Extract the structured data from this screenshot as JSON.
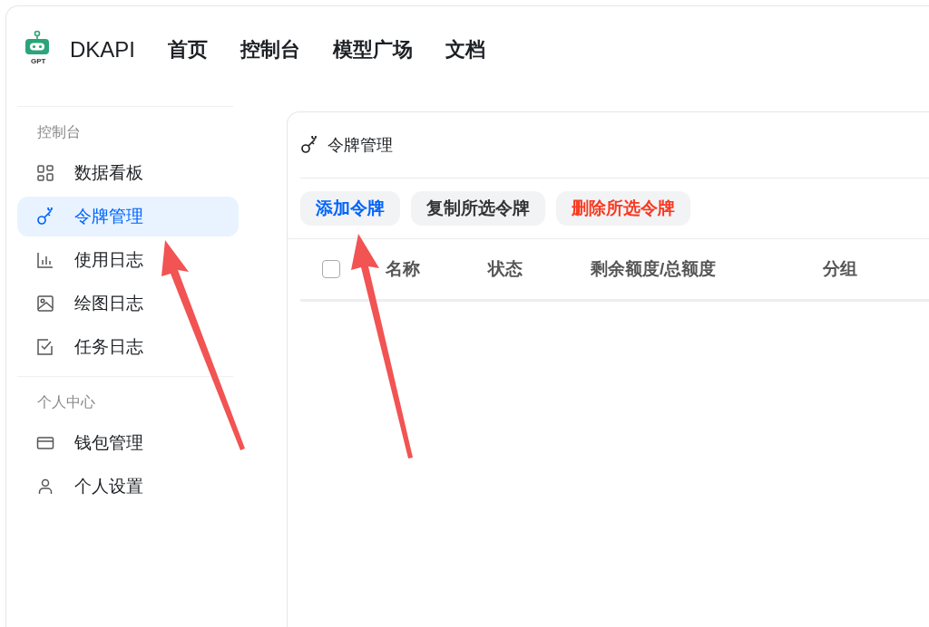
{
  "header": {
    "logo_caption": "GPT",
    "brand": "DKAPI",
    "nav": [
      {
        "label": "首页"
      },
      {
        "label": "控制台"
      },
      {
        "label": "模型广场"
      },
      {
        "label": "文档"
      }
    ]
  },
  "sidebar": {
    "sections": [
      {
        "title": "控制台",
        "items": [
          {
            "label": "数据看板",
            "selected": false
          },
          {
            "label": "令牌管理",
            "selected": true
          },
          {
            "label": "使用日志",
            "selected": false
          },
          {
            "label": "绘图日志",
            "selected": false
          },
          {
            "label": "任务日志",
            "selected": false
          }
        ]
      },
      {
        "title": "个人中心",
        "items": [
          {
            "label": "钱包管理",
            "selected": false
          },
          {
            "label": "个人设置",
            "selected": false
          }
        ]
      }
    ]
  },
  "panel": {
    "title": "令牌管理",
    "buttons": [
      {
        "label": "添加令牌",
        "kind": "primary"
      },
      {
        "label": "复制所选令牌",
        "kind": "secondary"
      },
      {
        "label": "删除所选令牌",
        "kind": "danger"
      }
    ],
    "table": {
      "select_all_checked": false,
      "columns": [
        "名称",
        "状态",
        "剩余额度/总额度",
        "分组"
      ]
    }
  }
}
